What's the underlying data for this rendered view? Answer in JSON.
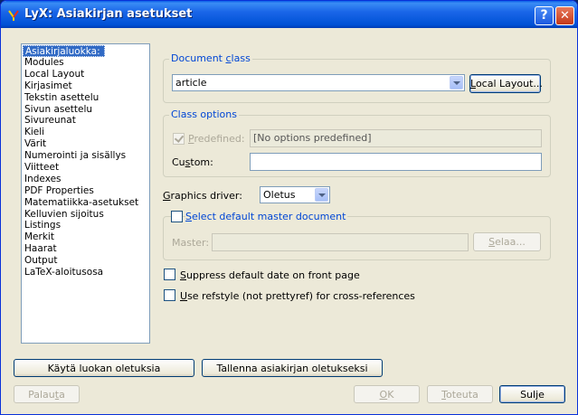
{
  "window": {
    "title": "LyX: Asiakirjan asetukset",
    "help_glyph": "?",
    "close_glyph": "✕",
    "icon": "lyx-app-icon"
  },
  "nav": {
    "items": [
      "Asiakirjaluokka:",
      "Modules",
      "Local Layout",
      "Kirjasimet",
      "Tekstin asettelu",
      "Sivun asettelu",
      "Sivureunat",
      "Kieli",
      "Värit",
      "Numerointi ja sisällys",
      "Viitteet",
      "Indexes",
      "PDF Properties",
      "Matematiikka-asetukset",
      "Kelluvien sijoitus",
      "Listings",
      "Merkit",
      "Haarat",
      "Output",
      "LaTeX-aloitusosa"
    ],
    "selected_index": 0
  },
  "doc_class": {
    "group_title_pre": "Document ",
    "group_title_u": "c",
    "group_title_post": "lass",
    "value": "article",
    "local_layout_u": "L",
    "local_layout_post": "ocal Layout..."
  },
  "class_options": {
    "group_title": "Class options",
    "predefined_u": "P",
    "predefined_post": "redefined:",
    "predefined_checked": true,
    "predefined_value": "[No options predefined]",
    "custom_pre": "Cu",
    "custom_u": "s",
    "custom_post": "tom:",
    "custom_value": ""
  },
  "graphics": {
    "label_u": "G",
    "label_post": "raphics driver:",
    "value": "Oletus"
  },
  "master": {
    "checkbox_u": "S",
    "checkbox_post": "elect default master document",
    "checked": false,
    "label": "Master:",
    "value": "",
    "browse_u": "S",
    "browse_post": "elaa..."
  },
  "options": {
    "suppress_date_u": "S",
    "suppress_date_post": "uppress default date on front page",
    "suppress_date_checked": false,
    "refstyle_u": "U",
    "refstyle_post": "se refstyle (not prettyref) for cross-references",
    "refstyle_checked": false
  },
  "buttons": {
    "use_class_defaults": "Käytä luokan oletuksia",
    "save_as_defaults": "Tallenna asiakirjan oletukseksi",
    "restore_pre": "Palau",
    "restore_u": "t",
    "restore_post": "a",
    "ok_u": "O",
    "ok_post": "K",
    "apply_u": "T",
    "apply_post": "oteuta",
    "close_pre": "Sul",
    "close_u": "j",
    "close_post": "e"
  }
}
